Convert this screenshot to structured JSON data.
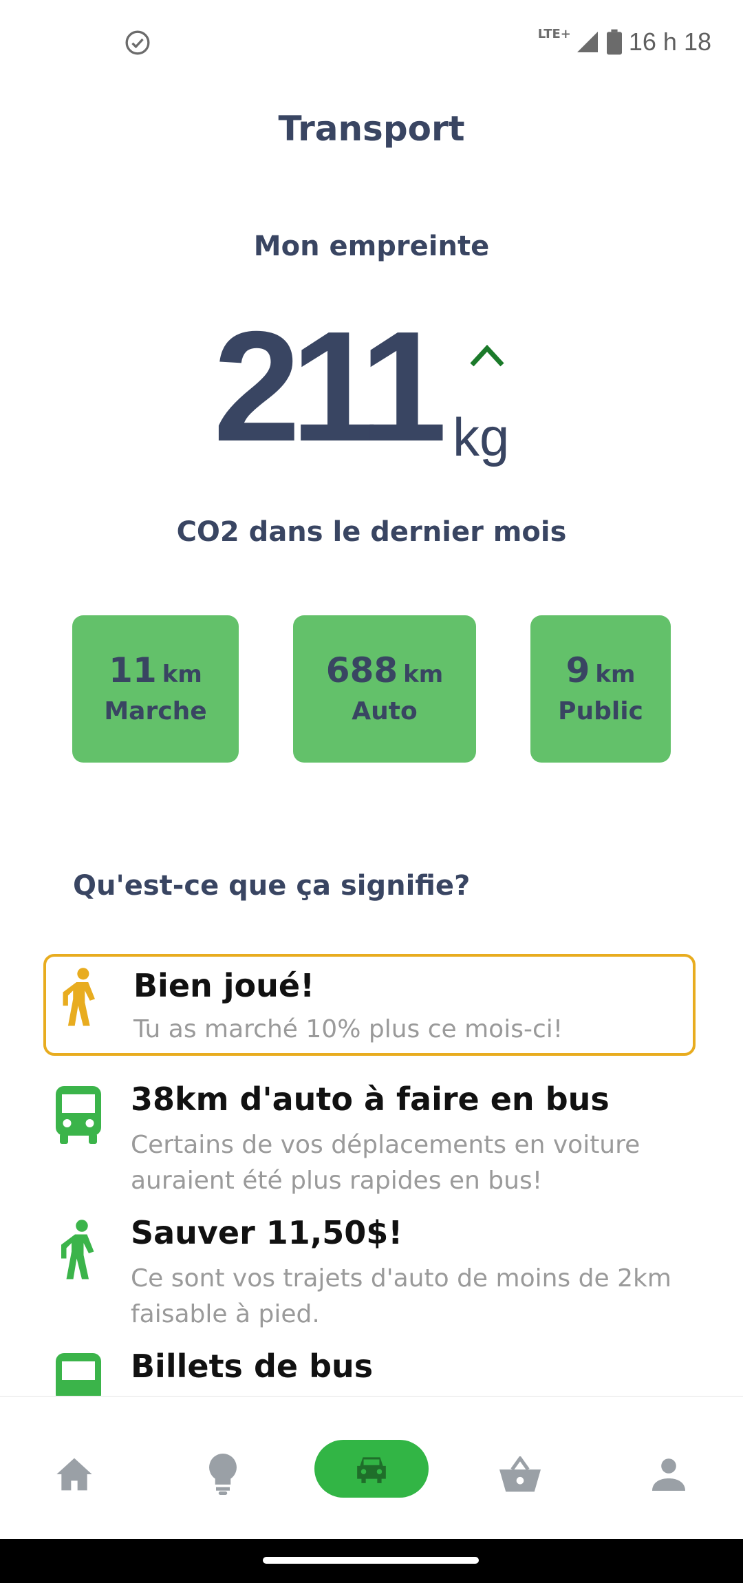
{
  "status_bar": {
    "network": "LTE+",
    "time": "16 h 18"
  },
  "header": {
    "title": "Transport"
  },
  "footprint": {
    "heading": "Mon empreinte",
    "value": "211",
    "unit": "kg",
    "trend": "up",
    "caption": "CO2 dans le dernier mois"
  },
  "stats": [
    {
      "value": "11",
      "unit": "km",
      "label": "Marche"
    },
    {
      "value": "688",
      "unit": "km",
      "label": "Auto"
    },
    {
      "value": "9",
      "unit": "km",
      "label": "Public"
    }
  ],
  "section": {
    "heading": "Qu'est-ce que ça signifie?"
  },
  "tips": [
    {
      "icon": "walking-person-icon",
      "title": "Bien joué!",
      "description": "Tu as marché 10% plus ce mois-ci!"
    },
    {
      "icon": "bus-icon",
      "title": "38km d'auto à faire en bus",
      "description_line1": "Certains de vos déplacements en voiture",
      "description_line2": "auraient été plus rapides en bus!"
    },
    {
      "icon": "walking-person-icon",
      "title": "Sauver 11,50$!",
      "description_line1": "Ce sont vos trajets d'auto de moins de 2km",
      "description_line2": "faisable à pied."
    },
    {
      "icon": "bus-icon",
      "title": "Billets de bus"
    }
  ],
  "bottom_nav": {
    "items": [
      "home-icon",
      "lightbulb-icon",
      "car-icon",
      "basket-icon",
      "profile-icon"
    ],
    "active": "car-icon"
  },
  "colors": {
    "primary_text": "#394562",
    "card_green": "#63c16a",
    "active_nav": "#32b545",
    "highlight_border": "#e8ac1f",
    "icon_green": "#3bb44a",
    "walk_yellow": "#e8ac1f",
    "trend_green": "#1b7a2a"
  }
}
